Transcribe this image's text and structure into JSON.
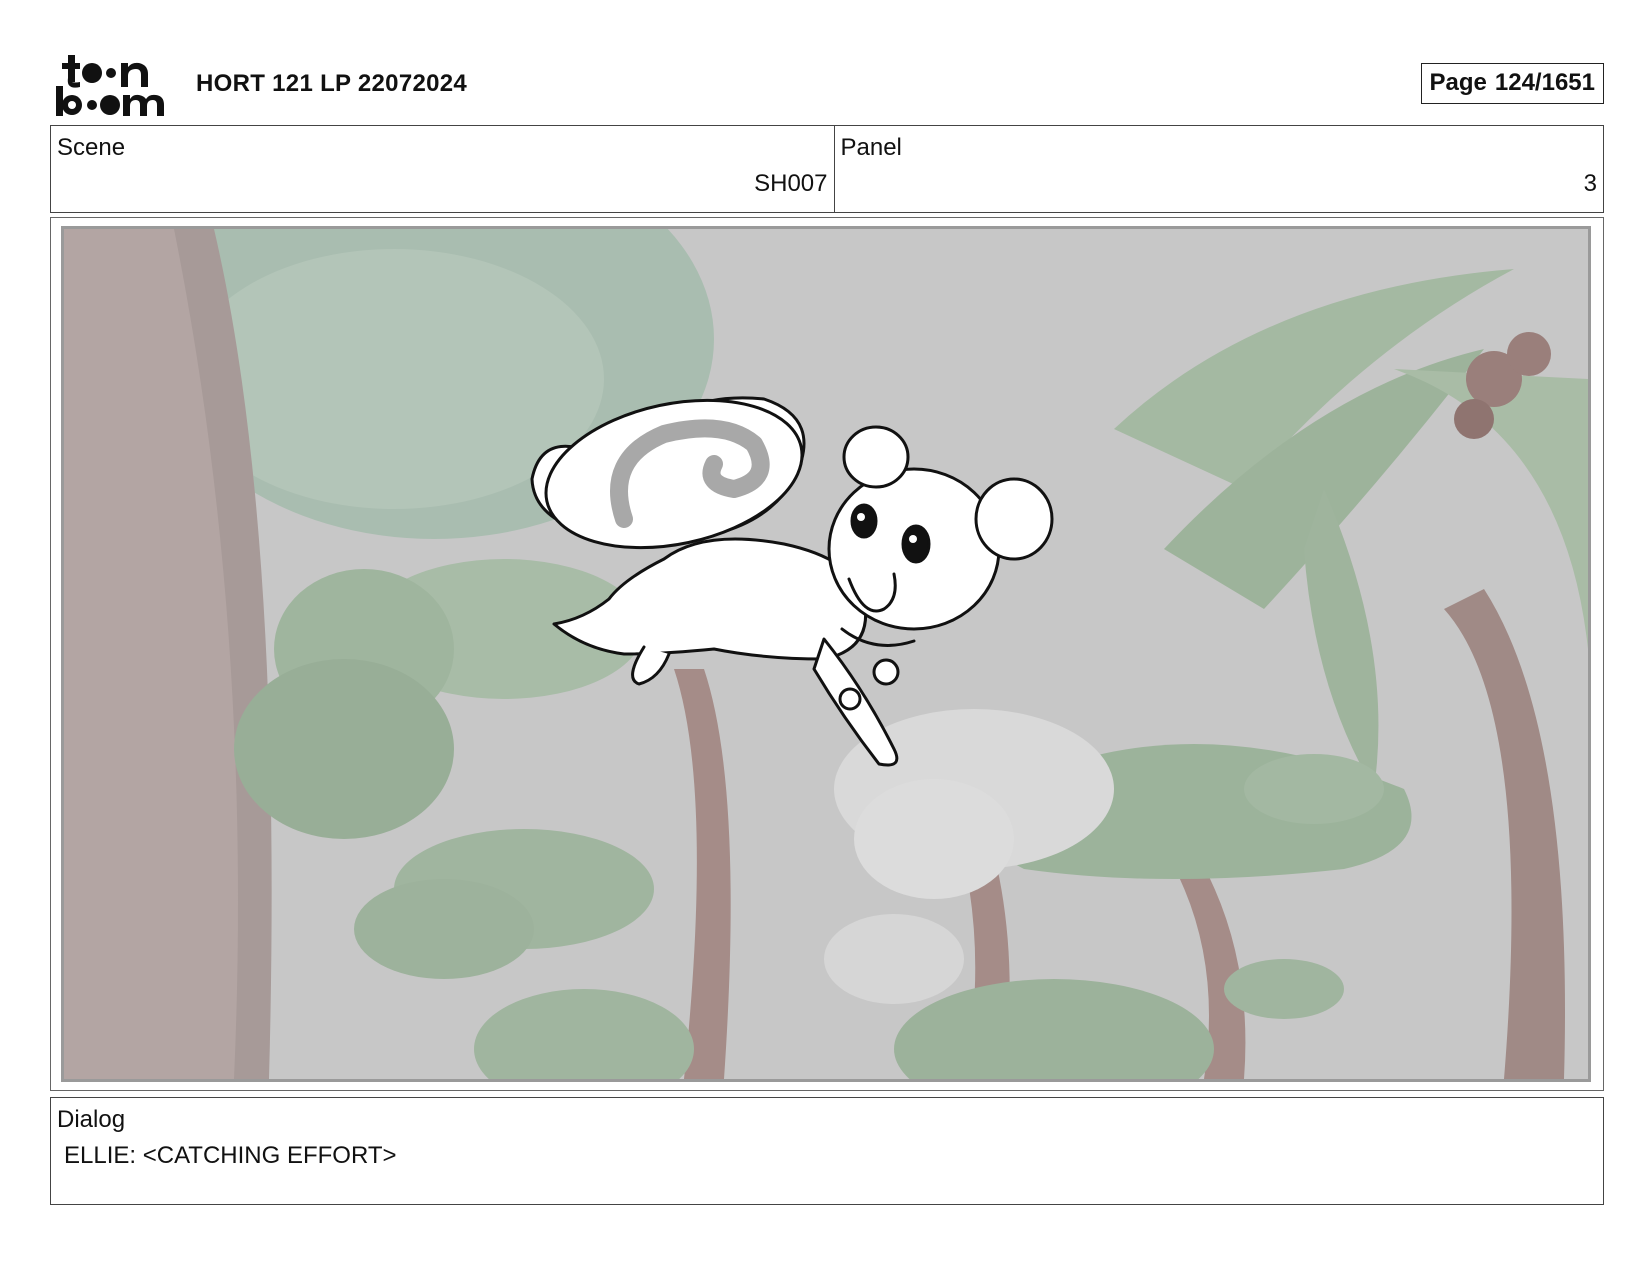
{
  "header": {
    "logo_text": "toonboom",
    "title": "HORT 121 LP 22072024",
    "page_label": "Page",
    "page_value": "124/1651"
  },
  "scene": {
    "label": "Scene",
    "value": "SH007"
  },
  "panel": {
    "label": "Panel",
    "value": "3"
  },
  "dialog": {
    "label": "Dialog",
    "text": "ELLIE: <CATCHING EFFORT>"
  },
  "colors": {
    "background_tint": "#c9c9c9",
    "foliage": "#8fae8a",
    "trunk": "#9b7f7a"
  },
  "icons": {
    "logo": "toon-boom-logo"
  }
}
